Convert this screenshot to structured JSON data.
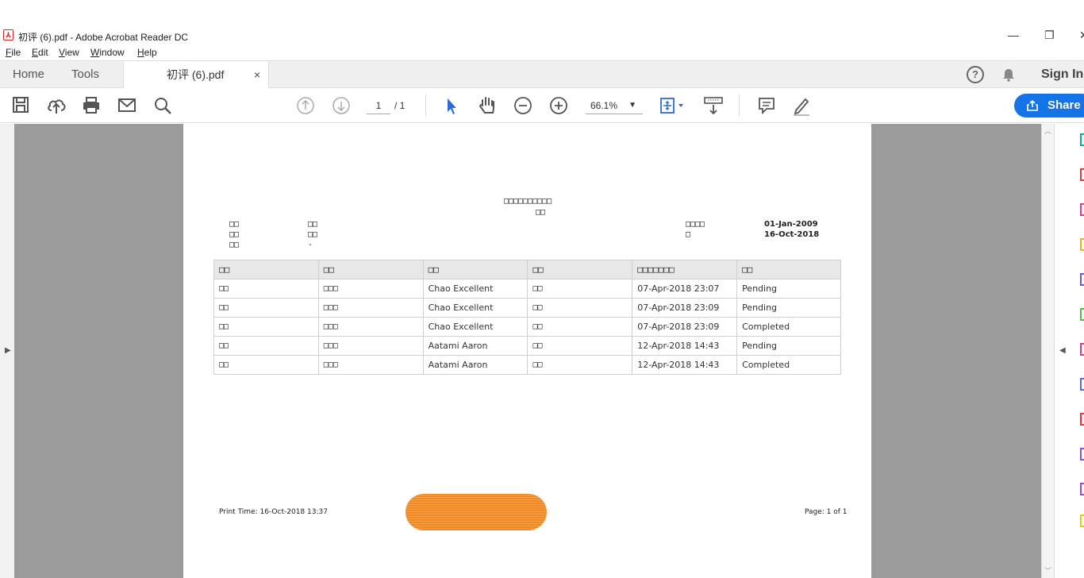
{
  "window": {
    "title": "初评 (6).pdf - Adobe Acrobat Reader DC",
    "controls": {
      "minimize": "—",
      "restore": "❐",
      "close": "✕"
    }
  },
  "menu": [
    "File",
    "Edit",
    "View",
    "Window",
    "Help"
  ],
  "tabs": {
    "home": "Home",
    "tools": "Tools",
    "document": "初评 (6).pdf",
    "close": "×",
    "sign_in": "Sign In"
  },
  "toolbar": {
    "page_current": "1",
    "page_total": "/ 1",
    "zoom": "66.1%",
    "share_label": "Share"
  },
  "pdf": {
    "title": "□□□□□□□□□□",
    "subtitle": "□□",
    "left_labels": [
      "□□",
      "□□",
      "□□"
    ],
    "left_values": [
      "□□",
      "□□",
      "-"
    ],
    "right_labels": [
      "□□□□",
      "□"
    ],
    "right_values": [
      "01-Jan-2009",
      "16-Oct-2018"
    ],
    "table": {
      "headers": [
        "□□",
        "□□",
        "□□",
        "□□",
        "□□□□□□□",
        "□□"
      ],
      "rows": [
        [
          "□□",
          "□□□",
          "Chao Excellent",
          "□□",
          "07-Apr-2018 23:07",
          "Pending"
        ],
        [
          "□□",
          "□□□",
          "Chao Excellent",
          "□□",
          "07-Apr-2018 23:09",
          "Pending"
        ],
        [
          "□□",
          "□□□",
          "Chao Excellent",
          "□□",
          "07-Apr-2018 23:09",
          "Completed"
        ],
        [
          "□□",
          "□□□",
          "Aatami Aaron",
          "□□",
          "12-Apr-2018 14:43",
          "Pending"
        ],
        [
          "□□",
          "□□□",
          "Aatami Aaron",
          "□□",
          "12-Apr-2018 14:43",
          "Completed"
        ]
      ]
    },
    "footer": {
      "print_time": "Print Time: 16-Oct-2018 13:37",
      "page": "Page: 1 of 1"
    }
  },
  "colors": {
    "accent": "#1473e6",
    "redaction": "#f08a24",
    "canvas": "#9b9b9b"
  }
}
